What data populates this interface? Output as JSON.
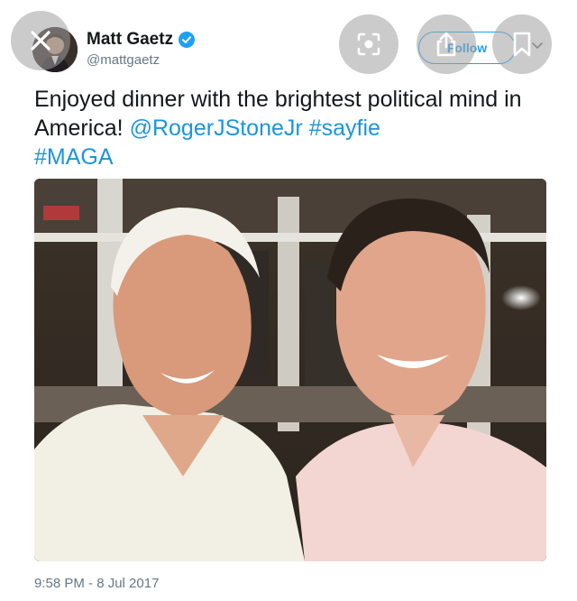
{
  "author": {
    "name": "Matt Gaetz",
    "handle": "@mattgaetz"
  },
  "follow_button": {
    "label": "Follow"
  },
  "tweet": {
    "text_plain": "Enjoyed dinner with the brightest political mind in America! ",
    "mention": "@RogerJStoneJr",
    "hashtag1": "#sayfie",
    "hashtag2": "#MAGA",
    "timestamp": "9:58 PM - 8 Jul 2017"
  },
  "icons": {
    "close": "close-icon",
    "verified": "verified-badge-icon",
    "lens": "lens-search-icon",
    "share": "share-icon",
    "bookmark": "bookmark-icon",
    "chevron": "chevron-down-icon"
  },
  "colors": {
    "accent": "#1da1f2",
    "link": "#1b95e0",
    "text": "#14171a",
    "muted": "#657786"
  }
}
